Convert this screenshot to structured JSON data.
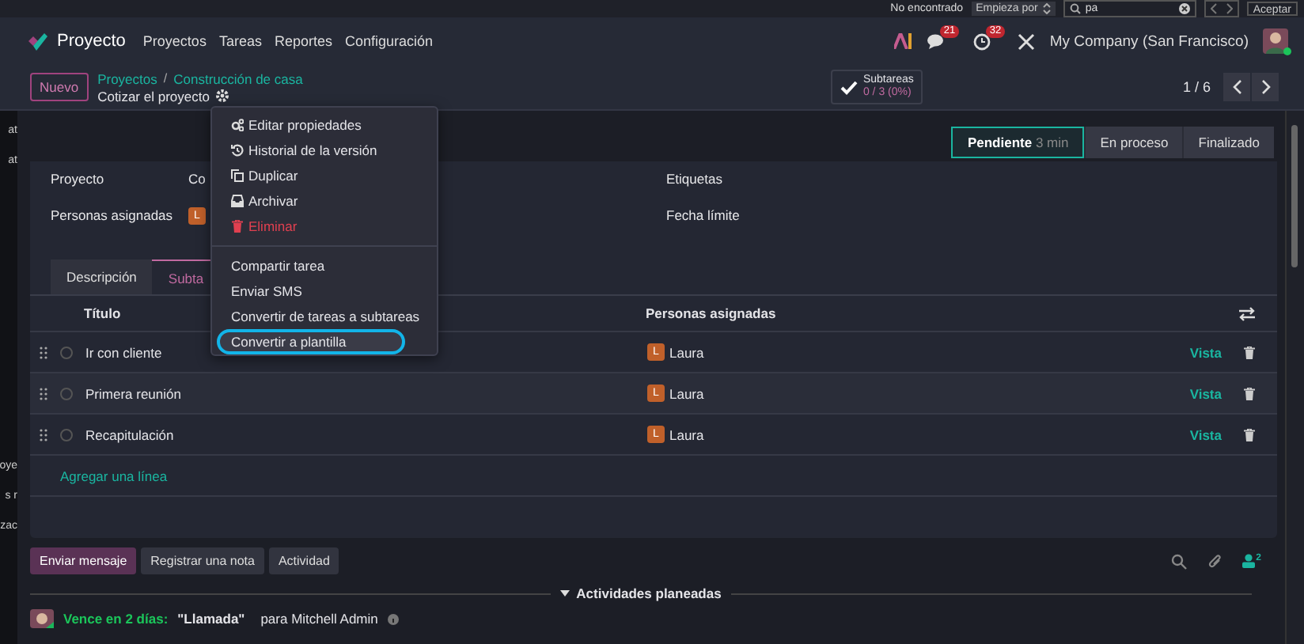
{
  "find_bar": {
    "status": "No encontrado",
    "mode": "Empieza por",
    "query": "pa",
    "accept": "Aceptar"
  },
  "navbar": {
    "app": "Proyecto",
    "menu": [
      "Proyectos",
      "Tareas",
      "Reportes",
      "Configuración"
    ],
    "messages_count": "21",
    "activities_count": "32",
    "company": "My Company (San Francisco)"
  },
  "background_window": {
    "fragments": [
      "at",
      "at",
      "oye",
      "s r",
      "zac"
    ]
  },
  "control_panel": {
    "new_button": "Nuevo",
    "breadcrumbs": [
      "Proyectos",
      "Construcción de casa"
    ],
    "breadcrumb_separator": "/",
    "record_title": "Cotizar el proyecto",
    "subtasks": {
      "label": "Subtareas",
      "progress": "0 / 3 (0%)",
      "complete": false
    },
    "pager": "1 / 6"
  },
  "status_stages": [
    {
      "label": "Pendiente",
      "duration": "3 min",
      "selected": true
    },
    {
      "label": "En proceso",
      "selected": false
    },
    {
      "label": "Finalizado",
      "selected": false
    }
  ],
  "fields_left": [
    {
      "label": "Proyecto",
      "value": "Co"
    },
    {
      "label": "Personas asignadas",
      "avatar": "L"
    }
  ],
  "fields_right": [
    {
      "label": "Etiquetas"
    },
    {
      "label": "Fecha límite"
    }
  ],
  "tabs": [
    {
      "label": "Descripción",
      "selected": false
    },
    {
      "label": "Subta",
      "selected": true
    }
  ],
  "subtasks_table": {
    "columns": [
      "Título",
      "Personas asignadas"
    ],
    "rows": [
      {
        "title": "Ir con cliente",
        "avatar": "L",
        "assignee": "Laura",
        "action": "Vista"
      },
      {
        "title": "Primera reunión",
        "avatar": "L",
        "assignee": "Laura",
        "action": "Vista"
      },
      {
        "title": "Recapitulación",
        "avatar": "L",
        "assignee": "Laura",
        "action": "Vista"
      }
    ],
    "add_line": "Agregar una línea"
  },
  "context_menu": {
    "groups": [
      [
        {
          "label": "Editar propiedades",
          "kind": "action",
          "highlighted": false
        },
        {
          "label": "Historial de la versión",
          "kind": "action",
          "highlighted": false
        },
        {
          "label": "Duplicar",
          "kind": "action",
          "highlighted": false
        },
        {
          "label": "Archivar",
          "kind": "action",
          "highlighted": false
        },
        {
          "label": "Eliminar",
          "kind": "danger",
          "highlighted": false
        }
      ],
      [
        {
          "label": "Compartir tarea",
          "kind": "plain",
          "highlighted": false
        },
        {
          "label": "Enviar SMS",
          "kind": "plain",
          "highlighted": false
        },
        {
          "label": "Convertir de tareas a subtareas",
          "kind": "plain",
          "highlighted": false
        },
        {
          "label": "Convertir a plantilla",
          "kind": "plain",
          "highlighted": true
        }
      ]
    ]
  },
  "chatter": {
    "buttons": [
      {
        "label": "Enviar mensaje",
        "selected": true
      },
      {
        "label": "Registrar una nota",
        "selected": false
      },
      {
        "label": "Actividad",
        "selected": false
      }
    ],
    "followers_count": "2",
    "activities_header": "Actividades planeadas",
    "activity": {
      "due": "Vence en 2 días:",
      "summary": "\"Llamada\"",
      "assignee": "para Mitchell Admin"
    }
  }
}
